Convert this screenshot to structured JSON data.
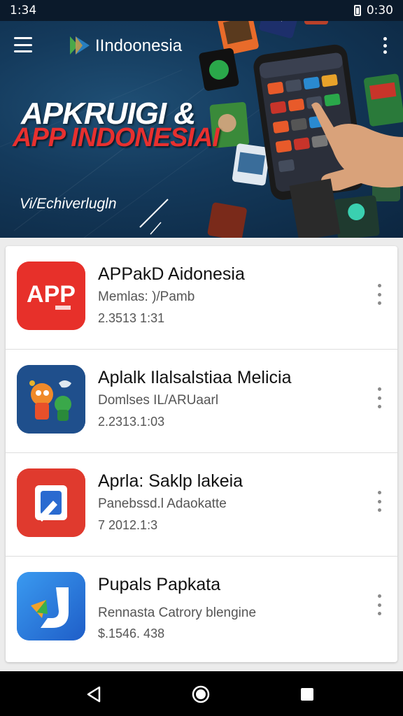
{
  "status_bar": {
    "time": "1:34",
    "right_text": "0:30"
  },
  "header": {
    "brand": "IIndoonesia"
  },
  "hero": {
    "title_line1": "APKRUIGI &",
    "title_line2": "APP INDONESIAI",
    "subtitle": "Vi/Echiverlugln"
  },
  "apps": [
    {
      "title": "APPakD Aidonesia",
      "subtitle": "Memlas: )/Pamb",
      "meta": "2.3513 1:31",
      "icon": "app-red-logo-icon",
      "icon_label": "APP"
    },
    {
      "title": "Aplalk Ilalsalstiaa Melicia",
      "subtitle": "Domlses IL/ARUaarl",
      "meta": "2.2313.1:03",
      "icon": "cartoon-characters-icon"
    },
    {
      "title": "Aprla: Saklp lakeia",
      "subtitle": "Panebssd.l Adaokatte",
      "meta": "7 2012.1:3",
      "icon": "red-frame-logo-icon"
    },
    {
      "title": "Pupals Papkata",
      "subtitle": "Rennasta Catrory blengine",
      "meta": "$.1546. 438",
      "icon": "blue-arrow-logo-icon"
    }
  ],
  "colors": {
    "hero_bg": "#143a5c",
    "title_red": "#e8302f",
    "app1_bg": "#e7302a",
    "app2_bg": "#1f4f8c",
    "app3_bg": "#e03a2e",
    "app4_bg": "#2f7ee0"
  }
}
